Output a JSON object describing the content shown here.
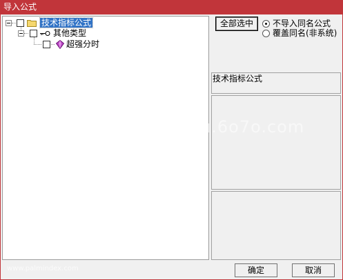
{
  "window": {
    "title": "导入公式"
  },
  "tree": {
    "root": {
      "label": "技术指标公式"
    },
    "child": {
      "label": "其他类型"
    },
    "leaf": {
      "label": "超强分时"
    }
  },
  "options": {
    "select_all_label": "全部选中",
    "radio_skip": "不导入同名公式",
    "radio_overwrite": "覆盖同名(非系统)",
    "selected": "radio_skip"
  },
  "info": {
    "category_text": "技术指标公式"
  },
  "footer": {
    "ok_label": "确定",
    "cancel_label": "取消"
  },
  "watermark": {
    "text": "u.6o7o.com",
    "site": "www.palmindex.com"
  },
  "colors": {
    "titlebar": "#c1353a",
    "selection": "#3173c6"
  }
}
